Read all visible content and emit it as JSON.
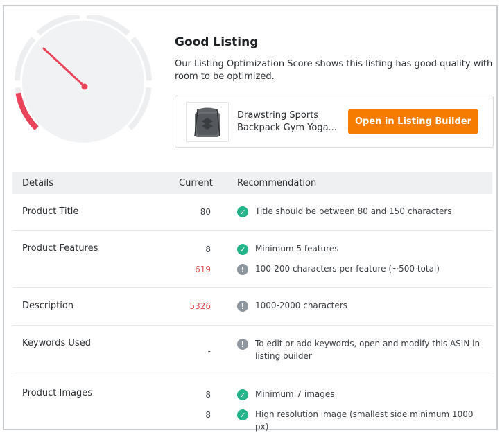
{
  "score": {
    "title": "Good Listing",
    "description": "Our Listing Optimization Score shows this listing has good quality with room to be optimized.",
    "gauge_level": 0.13,
    "gauge_color": "#e8445a",
    "needle_color": "#e8445a"
  },
  "product": {
    "name_line1": "Drawstring Sports",
    "name_line2": "Backpack Gym Yoga...",
    "open_button": "Open in Listing Builder",
    "button_color": "#f57c00"
  },
  "table": {
    "headers": {
      "details": "Details",
      "current": "Current",
      "recommendation": "Recommendation"
    },
    "rows": [
      {
        "label": "Product Title",
        "items": [
          {
            "current": "80",
            "status": "ok",
            "text": "Title should be between 80 and 150 characters"
          }
        ]
      },
      {
        "label": "Product Features",
        "items": [
          {
            "current": "8",
            "status": "ok",
            "text": "Minimum 5 features"
          },
          {
            "current": "619",
            "status": "warn",
            "text": "100-200 characters per feature (~500 total)"
          }
        ]
      },
      {
        "label": "Description",
        "items": [
          {
            "current": "5326",
            "status": "warn",
            "text": "1000-2000 characters"
          }
        ]
      },
      {
        "label": "Keywords Used",
        "items": [
          {
            "current": "-",
            "status": "warn",
            "text": "To edit or add keywords, open and modify this ASIN in listing builder"
          }
        ]
      },
      {
        "label": "Product Images",
        "items": [
          {
            "current": "8",
            "status": "ok",
            "text": "Minimum 7 images"
          },
          {
            "current": "8",
            "status": "ok",
            "text": "High resolution image (smallest side minimum 1000 px)"
          }
        ]
      }
    ]
  },
  "icons": {
    "ok": "check-circle-icon",
    "warn": "exclamation-circle-icon"
  },
  "colors": {
    "ok": "#24b38a",
    "warn": "#8d969e",
    "over_limit": "#e5484d"
  }
}
